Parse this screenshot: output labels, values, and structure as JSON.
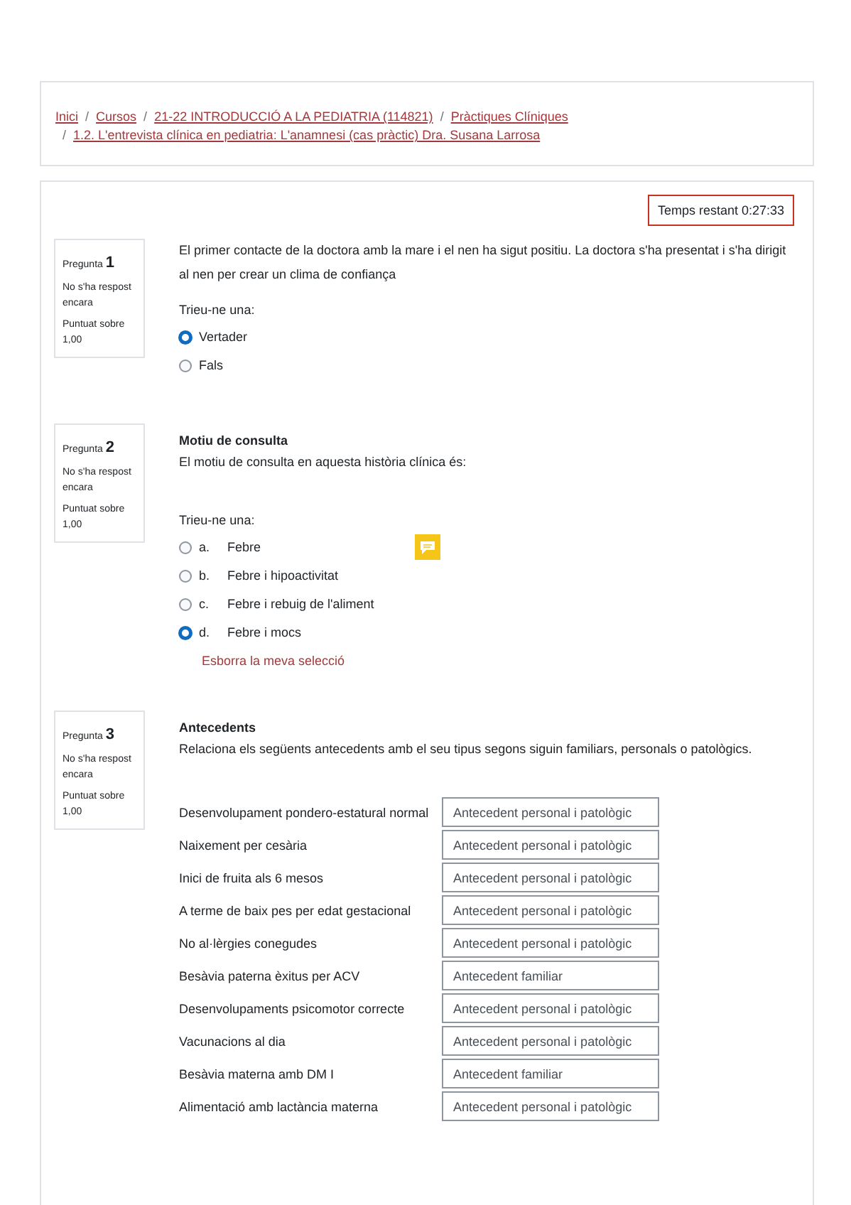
{
  "breadcrumb": {
    "items": [
      {
        "label": "Inici"
      },
      {
        "label": "Cursos"
      },
      {
        "label": "21-22 INTRODUCCIÓ A LA PEDIATRIA (114821)"
      },
      {
        "label": "Pràctiques Clíniques"
      },
      {
        "label": "1.2. L'entrevista clínica en pediatria: L'anamnesi (cas pràctic) Dra. Susana Larrosa"
      }
    ],
    "separator": "/"
  },
  "timer": "Temps restant 0:27:33",
  "questions": [
    {
      "kind": "truefalse",
      "label": "Pregunta",
      "number": "1",
      "status": "No s'ha respost encara",
      "marks": "Puntuat sobre 1,00",
      "text": "El primer contacte de la doctora amb la mare i el nen ha sigut positiu. La doctora s'ha presentat i s'ha dirigit al nen per crear un clima de confiança",
      "prompt": "Trieu-ne una:",
      "options": [
        {
          "text": "Vertader",
          "selected": true
        },
        {
          "text": "Fals",
          "selected": false
        }
      ]
    },
    {
      "kind": "multichoice",
      "label": "Pregunta",
      "number": "2",
      "status": "No s'ha respost encara",
      "marks": "Puntuat sobre 1,00",
      "title": "Motiu de consulta",
      "text": "El motiu de consulta en aquesta història clínica és:",
      "prompt": "Trieu-ne una:",
      "options": [
        {
          "letter": "a.",
          "text": "Febre",
          "selected": false
        },
        {
          "letter": "b.",
          "text": "Febre i hipoactivitat",
          "selected": false
        },
        {
          "letter": "c.",
          "text": "Febre i rebuig de l'aliment",
          "selected": false
        },
        {
          "letter": "d.",
          "text": "Febre i mocs",
          "selected": true
        }
      ],
      "clear": "Esborra la meva selecció"
    },
    {
      "kind": "match",
      "label": "Pregunta",
      "number": "3",
      "status": "No s'ha respost encara",
      "marks": "Puntuat sobre 1,00",
      "title": "Antecedents",
      "text": "Relaciona els següents antecedents amb el seu tipus segons siguin familiars, personals o patològics.",
      "pairs": [
        {
          "item": "Desenvolupament pondero-estatural normal",
          "answer": "Antecedent personal i patològic"
        },
        {
          "item": "Naixement per cesària",
          "answer": "Antecedent personal i patològic"
        },
        {
          "item": "Inici de fruita als 6 mesos",
          "answer": "Antecedent personal i patològic"
        },
        {
          "item": "A terme de baix pes per edat gestacional",
          "answer": "Antecedent personal i patològic"
        },
        {
          "item": "No al·lèrgies conegudes",
          "answer": "Antecedent personal i patològic"
        },
        {
          "item": "Besàvia paterna èxitus per ACV",
          "answer": "Antecedent familiar"
        },
        {
          "item": "Desenvolupaments psicomotor correcte",
          "answer": "Antecedent personal i patològic"
        },
        {
          "item": "Vacunacions al dia",
          "answer": "Antecedent personal i patològic"
        },
        {
          "item": "Besàvia materna amb DM I",
          "answer": "Antecedent familiar"
        },
        {
          "item": "Alimentació amb lactància materna",
          "answer": "Antecedent personal i patològic"
        }
      ]
    }
  ]
}
